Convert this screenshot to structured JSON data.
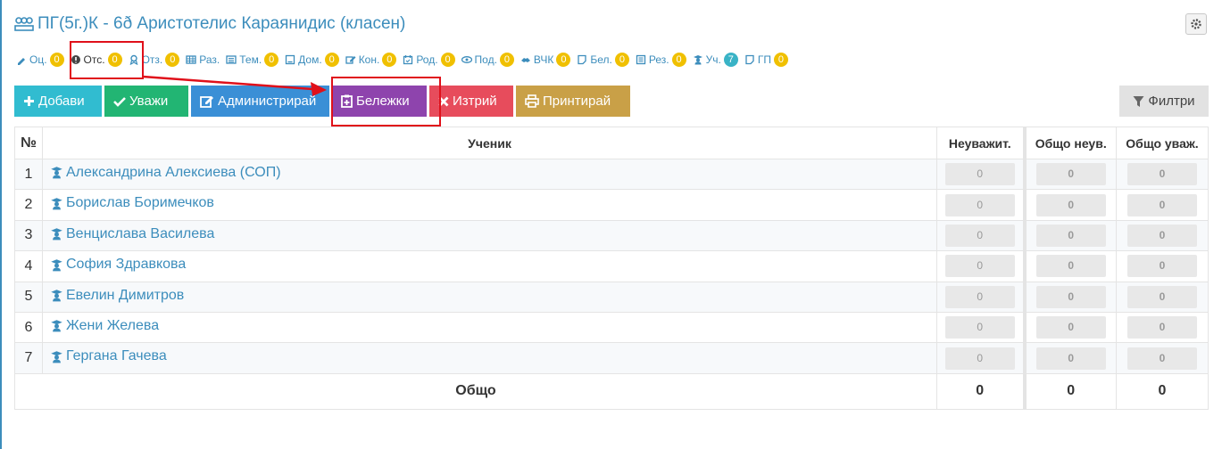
{
  "header": {
    "title": "ПГ(5г.)К - 6ð Аристотелис Караянидис (класен)"
  },
  "tabs": [
    {
      "label": "Оц.",
      "count": "0",
      "icon": "pencil-icon"
    },
    {
      "label": "Отс.",
      "count": "0",
      "icon": "exclamation-circle-icon"
    },
    {
      "label": "Отз.",
      "count": "0",
      "icon": "award-icon"
    },
    {
      "label": "Раз.",
      "count": "",
      "icon": "table-icon"
    },
    {
      "label": "Тем.",
      "count": "0",
      "icon": "list-icon"
    },
    {
      "label": "Дом.",
      "count": "0",
      "icon": "home-box-icon"
    },
    {
      "label": "Кон.",
      "count": "0",
      "icon": "edit-icon"
    },
    {
      "label": "Род.",
      "count": "0",
      "icon": "calendar-icon"
    },
    {
      "label": "Под.",
      "count": "0",
      "icon": "eye-icon"
    },
    {
      "label": "ВЧК",
      "count": "0",
      "icon": "handshake-icon"
    },
    {
      "label": "Бел.",
      "count": "0",
      "icon": "note-icon"
    },
    {
      "label": "Рез.",
      "count": "0",
      "icon": "list-alt-icon"
    },
    {
      "label": "Уч.",
      "count": "7",
      "icon": "graduate-icon"
    },
    {
      "label": "ГП",
      "count": "0",
      "icon": "note-icon"
    }
  ],
  "toolbar": {
    "add": "Добави",
    "excuse": "Уважи",
    "administer": "Администрирай",
    "notes": "Бележки",
    "delete": "Изтрий",
    "print": "Принтирай",
    "filters": "Филтри"
  },
  "table": {
    "headers": {
      "num": "№",
      "student": "Ученик",
      "unexcused": "Неуважит.",
      "total_unexcused": "Общо неув.",
      "total_excused": "Общо уваж."
    },
    "rows": [
      {
        "num": "1",
        "name": "Александрина Алексиева (СОП)",
        "unexcused": "0",
        "total_unexcused": "0",
        "total_excused": "0"
      },
      {
        "num": "2",
        "name": "Борислав Боримечков",
        "unexcused": "0",
        "total_unexcused": "0",
        "total_excused": "0"
      },
      {
        "num": "3",
        "name": "Венцислава Василева",
        "unexcused": "0",
        "total_unexcused": "0",
        "total_excused": "0"
      },
      {
        "num": "4",
        "name": "София Здравкова",
        "unexcused": "0",
        "total_unexcused": "0",
        "total_excused": "0"
      },
      {
        "num": "5",
        "name": "Евелин Димитров",
        "unexcused": "0",
        "total_unexcused": "0",
        "total_excused": "0"
      },
      {
        "num": "6",
        "name": "Жени Желева",
        "unexcused": "0",
        "total_unexcused": "0",
        "total_excused": "0"
      },
      {
        "num": "7",
        "name": "Гергана Гачева",
        "unexcused": "0",
        "total_unexcused": "0",
        "total_excused": "0"
      }
    ],
    "footer": {
      "label": "Общо",
      "unexcused": "0",
      "total_unexcused": "0",
      "total_excused": "0"
    }
  },
  "colors": {
    "accent": "#3c8dbc",
    "badge": "#f0c000",
    "annotation": "#e0101a"
  }
}
